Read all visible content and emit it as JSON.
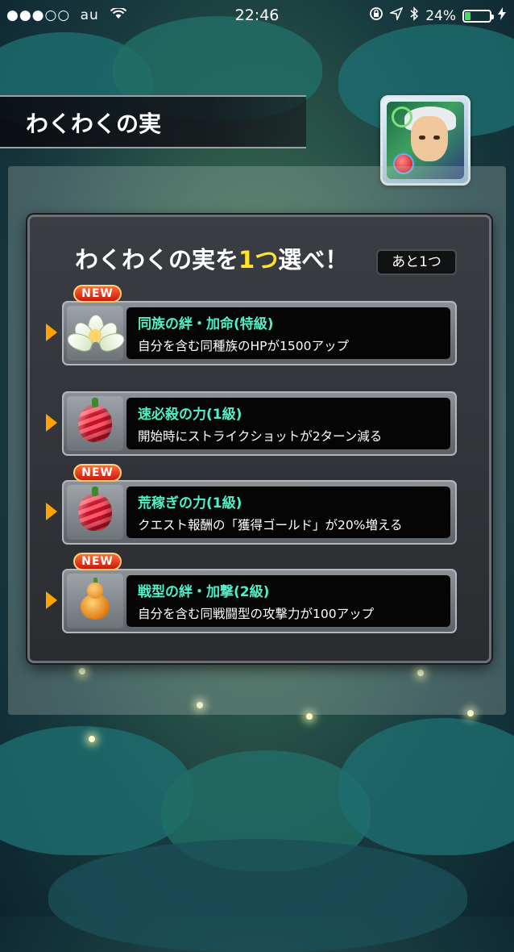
{
  "status_bar": {
    "signal": "●●●○○",
    "carrier": "au",
    "time": "22:46",
    "battery_percent": "24%",
    "battery_level": 0.24
  },
  "screen_title": "わくわくの実",
  "panel": {
    "heading_prefix": "わくわくの実を",
    "heading_highlight": "1つ",
    "heading_suffix": "選べ！",
    "remaining_label": "あと1つ"
  },
  "choices": [
    {
      "name": "同族の絆・加命(特級)",
      "description": "自分を含む同種族のHPが1500アップ",
      "badge": "NEW",
      "icon": "lotus-fruit-icon"
    },
    {
      "name": "速必殺の力(1級)",
      "description": "開始時にストライクショットが2ターン減る",
      "badge": "",
      "icon": "red-fruit-icon"
    },
    {
      "name": "荒稼ぎの力(1級)",
      "description": "クエスト報酬の「獲得ゴールド」が20%増える",
      "badge": "NEW",
      "icon": "red-fruit-icon"
    },
    {
      "name": "戦型の絆・加撃(2級)",
      "description": "自分を含む同戦闘型の攻撃力が100アップ",
      "badge": "NEW",
      "icon": "gourd-fruit-icon"
    }
  ],
  "colors": {
    "highlight": "#ffe52a",
    "name_text": "#4ff0c8",
    "arrow": "#ffa400",
    "new_badge": "#d8261a"
  }
}
